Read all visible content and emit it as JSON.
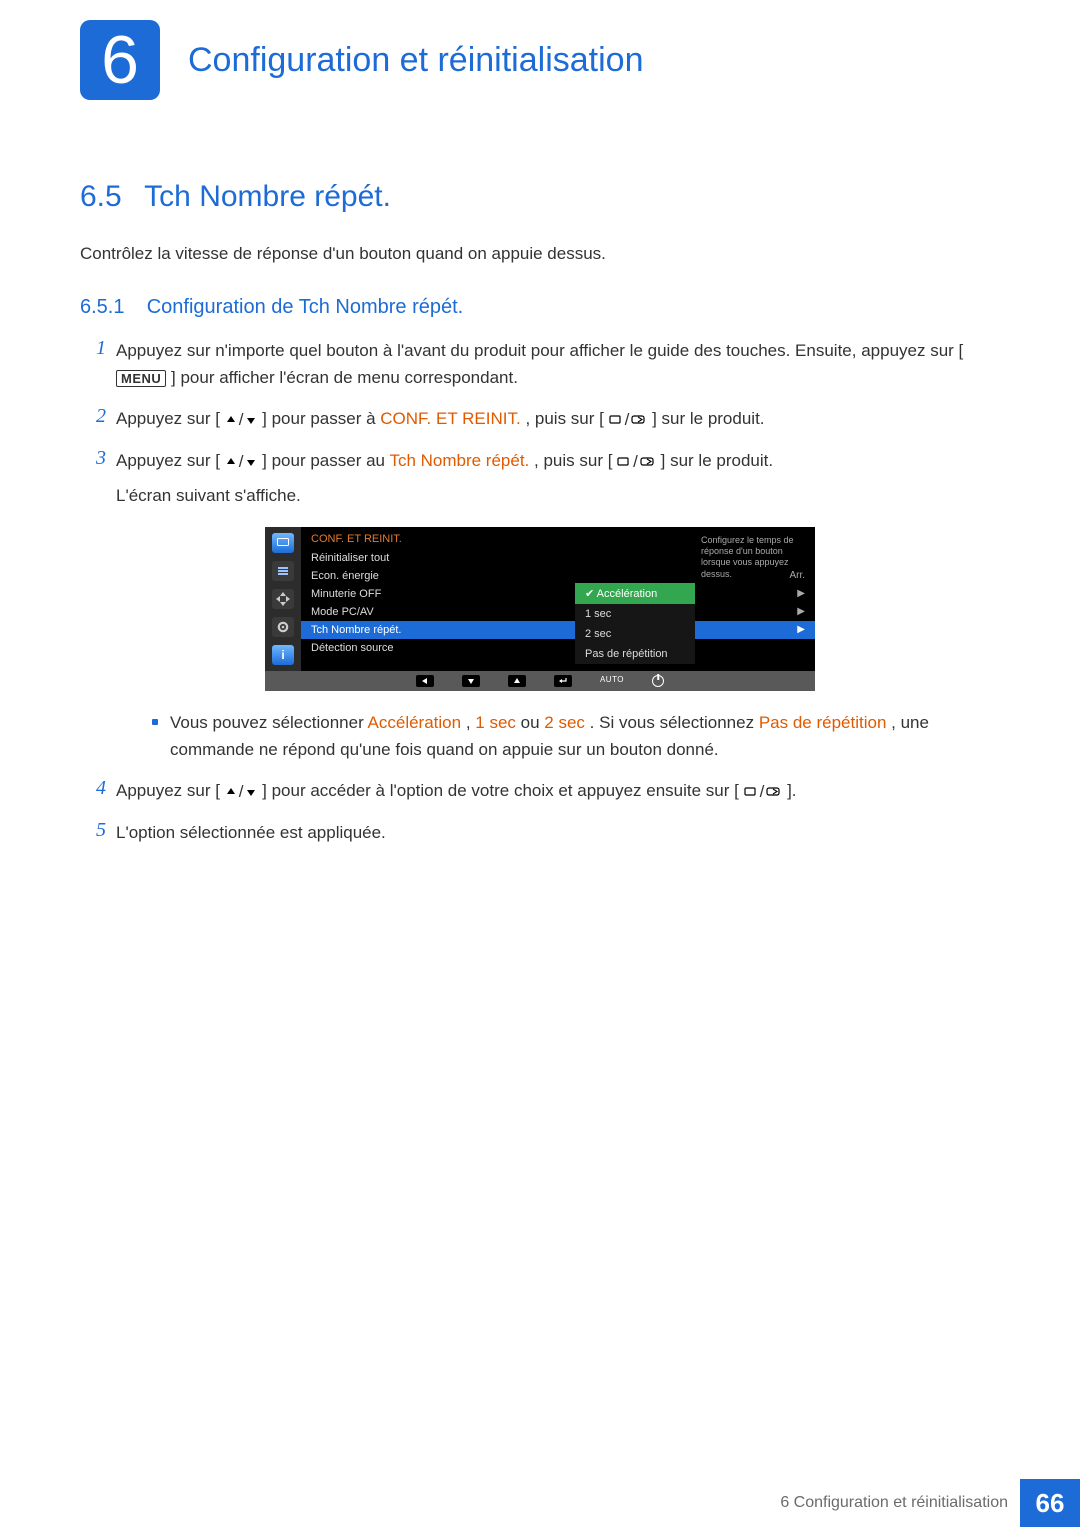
{
  "chapter": {
    "number": "6",
    "title": "Configuration et réinitialisation"
  },
  "section": {
    "number": "6.5",
    "title": "Tch Nombre répét."
  },
  "intro": "Contrôlez la vitesse de réponse d'un bouton quand on appuie dessus.",
  "subsection": {
    "number": "6.5.1",
    "title": "Configuration de Tch Nombre répét."
  },
  "steps": {
    "s1": {
      "a": "Appuyez sur n'importe quel bouton à l'avant du produit pour afficher le guide des touches. Ensuite, appuyez sur [",
      "key": "MENU",
      "b": "] pour afficher l'écran de menu correspondant."
    },
    "s2": {
      "a": "Appuyez sur [",
      "b": "] pour passer à ",
      "hl": "CONF. ET REINIT.",
      "c": ", puis sur [",
      "d": "] sur le produit."
    },
    "s3": {
      "a": "Appuyez sur [",
      "b": "] pour passer au ",
      "hl": "Tch Nombre répét.",
      "c": ", puis sur [",
      "d": "] sur le produit.",
      "e": "L'écran suivant s'affiche."
    },
    "s4": {
      "a": "Appuyez sur [",
      "b": "] pour accéder à l'option de votre choix et appuyez ensuite sur [",
      "c": "]."
    },
    "s5": "L'option sélectionnée est appliquée."
  },
  "bullet": {
    "a": "Vous pouvez sélectionner ",
    "hl1": "Accélération",
    "b": ", ",
    "hl2": "1 sec",
    "c": " ou ",
    "hl3": "2 sec",
    "d": ". Si vous sélectionnez ",
    "hl4": "Pas de répétition",
    "e": ", une commande ne répond qu'une fois quand on appuie sur un bouton donné."
  },
  "osd": {
    "header": "CONF. ET REINIT.",
    "items": {
      "reset": "Réinitialiser tout",
      "eco": "Econ. énergie",
      "eco_val": "Arr.",
      "timer": "Minuterie OFF",
      "mode": "Mode PC/AV",
      "repeat": "Tch Nombre répét.",
      "detect": "Détection source"
    },
    "submenu": {
      "opt1": "Accélération",
      "opt2": "1 sec",
      "opt3": "2 sec",
      "opt4": "Pas de répétition"
    },
    "help": "Configurez le temps de réponse d'un bouton lorsque vous appuyez dessus.",
    "bottom_auto": "AUTO"
  },
  "footer": {
    "chapter_label": "6 Configuration et réinitialisation",
    "page": "66"
  }
}
